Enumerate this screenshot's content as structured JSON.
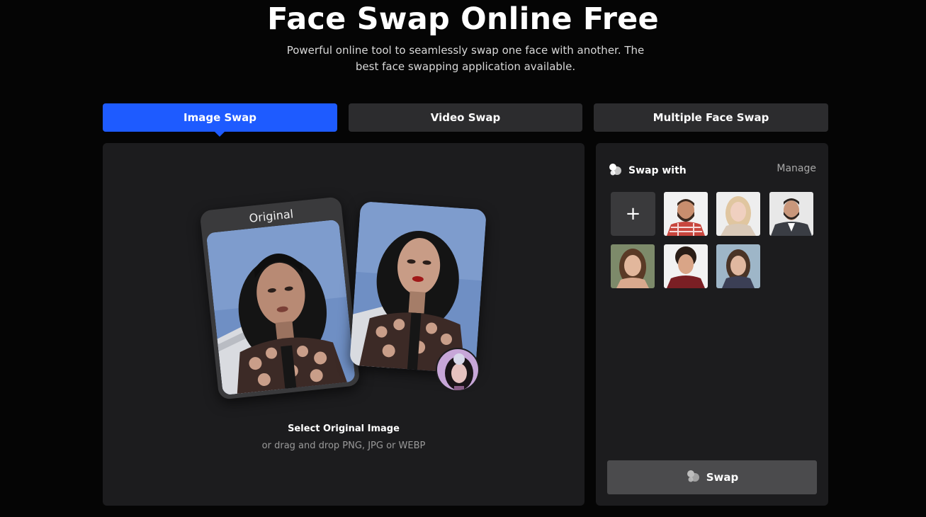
{
  "header": {
    "title": "Face Swap Online Free",
    "subtitle": "Powerful online tool to seamlessly swap one face with another. The best face swapping application available."
  },
  "tabs": [
    {
      "label": "Image Swap",
      "active": true
    },
    {
      "label": "Video Swap",
      "active": false
    },
    {
      "label": "Multiple Face Swap",
      "active": false
    }
  ],
  "upload": {
    "card_label": "Original",
    "title": "Select Original Image",
    "hint": "or drag and drop PNG, JPG or WEBP"
  },
  "swap_panel": {
    "heading": "Swap with",
    "manage_label": "Manage",
    "add_label": "+",
    "faces": [
      {
        "name": "bearded-man-plaid-shirt"
      },
      {
        "name": "blonde-woman"
      },
      {
        "name": "man-in-suit"
      },
      {
        "name": "brunette-woman"
      },
      {
        "name": "curly-haired-young-man"
      },
      {
        "name": "young-woman-dark-hair"
      }
    ],
    "swap_button_label": "Swap"
  },
  "colors": {
    "accent": "#1e5bff",
    "background": "#050505",
    "panel": "#1c1c1e",
    "tab_inactive": "#2c2c2e",
    "swap_button": "#4b4b4d"
  }
}
